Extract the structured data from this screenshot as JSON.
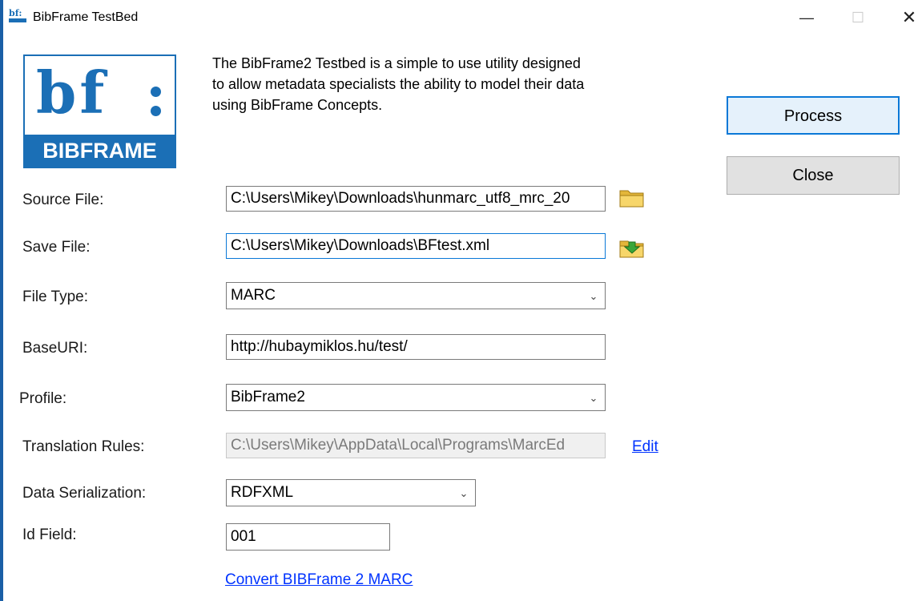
{
  "window": {
    "title": "BibFrame TestBed",
    "icon_label": "bf:",
    "controls": {
      "minimize": "—",
      "maximize": "☐",
      "close": "✕"
    }
  },
  "logo": {
    "mark": "bf",
    "banner": "BIBFRAME"
  },
  "intro": "The BibFrame2 Testbed is a simple to use utility designed\nto allow metadata specialists the ability to model their data\nusing BibFrame Concepts.",
  "fields": {
    "source_file": {
      "label": "Source File:",
      "value": "C:\\Users\\Mikey\\Downloads\\hunmarc_utf8_mrc_20"
    },
    "save_file": {
      "label": "Save File:",
      "value": "C:\\Users\\Mikey\\Downloads\\BFtest.xml"
    },
    "file_type": {
      "label": "File Type:",
      "value": "MARC"
    },
    "base_uri": {
      "label": "BaseURI:",
      "value": "http://hubaymiklos.hu/test/"
    },
    "profile": {
      "label": "Profile:",
      "value": "BibFrame2"
    },
    "translation_rules": {
      "label": "Translation Rules:",
      "value": "C:\\Users\\Mikey\\AppData\\Local\\Programs\\MarcEd",
      "edit_link": "Edit"
    },
    "data_serialization": {
      "label": "Data Serialization:",
      "value": "RDFXML"
    },
    "id_field": {
      "label": "Id Field:",
      "value": "001"
    }
  },
  "buttons": {
    "process": "Process",
    "close": "Close"
  },
  "convert_link": "Convert BIBFrame 2 MARC",
  "colors": {
    "accent": "#1b6fb6",
    "focus": "#0a78d7",
    "link": "#0033ff",
    "desktop": "#1a5fa6"
  },
  "icons": {
    "browse": "folder-icon",
    "save": "folder-save-icon",
    "dropdown": "chevron-down-icon"
  }
}
